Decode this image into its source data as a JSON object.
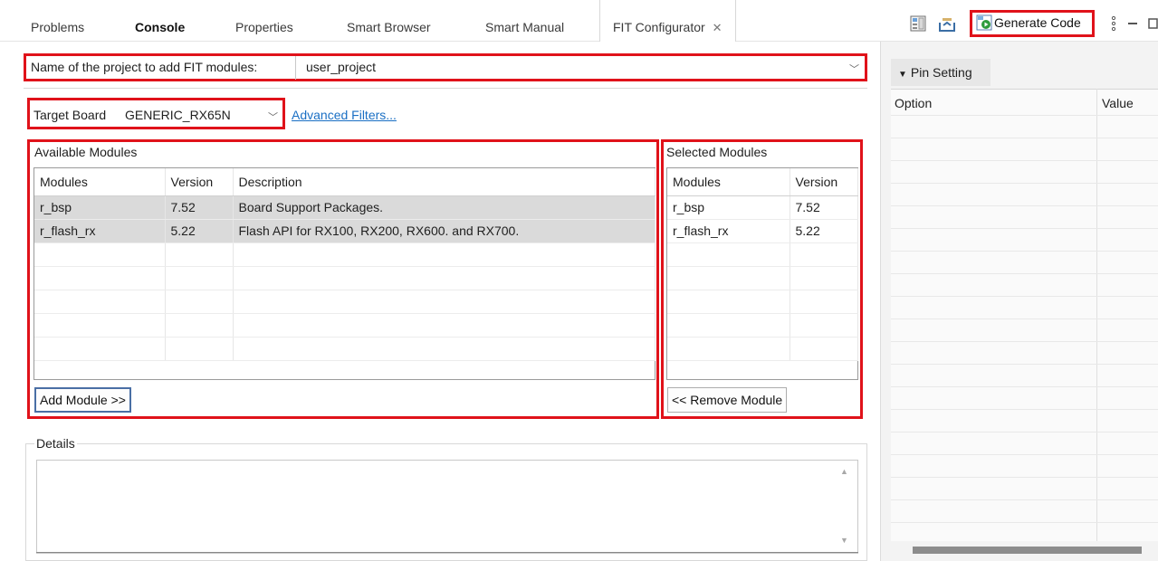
{
  "tabs": [
    {
      "label": "Problems",
      "bold": false
    },
    {
      "label": "Console",
      "bold": true
    },
    {
      "label": "Properties",
      "bold": false
    },
    {
      "label": "Smart Browser",
      "bold": false
    },
    {
      "label": "Smart Manual",
      "bold": false
    },
    {
      "label": "FIT Configurator",
      "bold": false,
      "active": true
    }
  ],
  "tab_close_glyph": "✕",
  "toolbar": {
    "generate_code_label": "Generate Code",
    "icons": [
      "module-view-icon",
      "import-icon",
      "generate-code-icon",
      "more-vertical-icon",
      "minimize-icon",
      "maximize-icon"
    ]
  },
  "project": {
    "label": "Name of the project to add FIT modules:",
    "value": "user_project"
  },
  "target_board": {
    "label": "Target Board",
    "value": "GENERIC_RX65N",
    "advanced_filters_label": "Advanced Filters..."
  },
  "available_modules": {
    "title": "Available Modules",
    "columns": [
      "Modules",
      "Version",
      "Description"
    ],
    "rows": [
      {
        "module": "r_bsp",
        "version": "7.52",
        "description": "Board Support Packages."
      },
      {
        "module": "r_flash_rx",
        "version": "5.22",
        "description": "Flash API for RX100, RX200, RX600. and RX700."
      }
    ],
    "add_button_label": "Add Module >>"
  },
  "selected_modules": {
    "title": "Selected Modules",
    "columns": [
      "Modules",
      "Version"
    ],
    "rows": [
      {
        "module": "r_bsp",
        "version": "7.52"
      },
      {
        "module": "r_flash_rx",
        "version": "5.22"
      }
    ],
    "remove_button_label": "<< Remove Module"
  },
  "details": {
    "title": "Details"
  },
  "pin_setting": {
    "label": "Pin Setting",
    "columns": [
      "Option",
      "Value"
    ]
  },
  "colors": {
    "highlight_box": "#e0121a",
    "link": "#1a6fc4",
    "selected_row": "#dadada"
  }
}
